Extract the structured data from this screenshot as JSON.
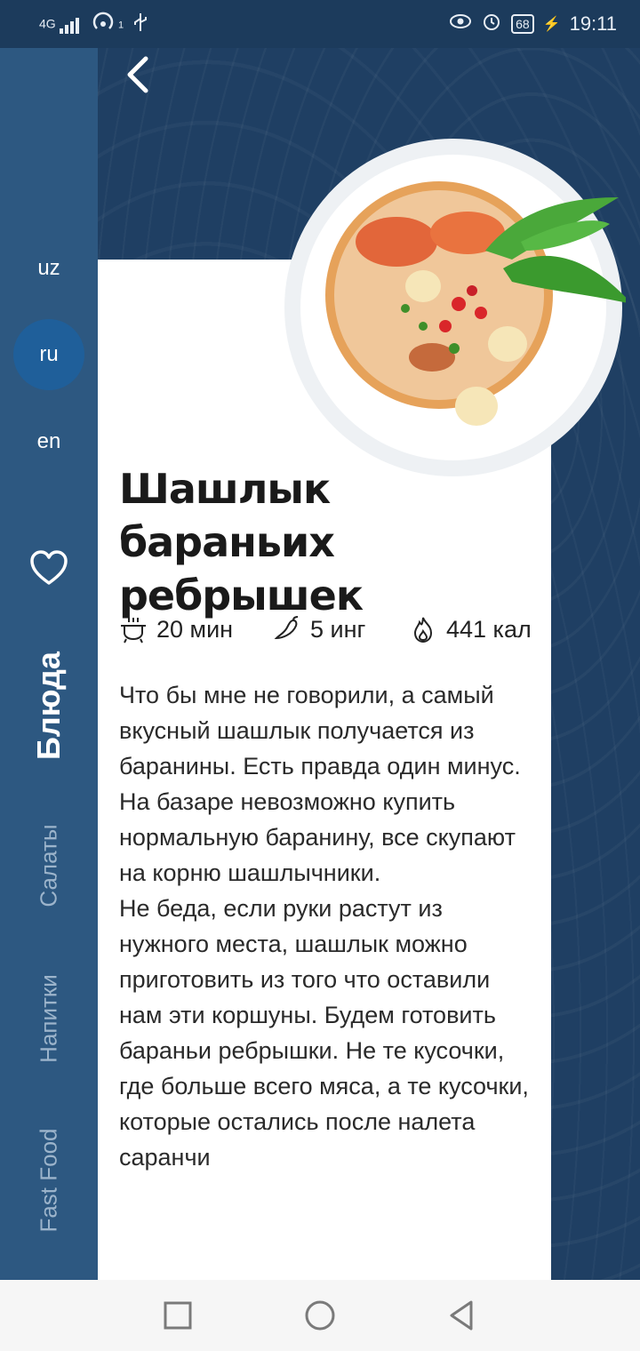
{
  "status_bar": {
    "network": "4G",
    "hotspot_count": "1",
    "battery": "68",
    "time": "19:11"
  },
  "languages": [
    {
      "code": "uz",
      "active": false
    },
    {
      "code": "ru",
      "active": true
    },
    {
      "code": "en",
      "active": false
    }
  ],
  "categories": [
    {
      "label": "Блюда",
      "active": true
    },
    {
      "label": "Салаты",
      "active": false
    },
    {
      "label": "Напитки",
      "active": false
    },
    {
      "label": "Fast Food",
      "active": false
    }
  ],
  "recipe": {
    "title": "Шашлык бараньих ребрышек",
    "time": "20 мин",
    "ingredients": "5 инг",
    "calories": "441 кал",
    "description": "Что бы мне не говорили, а самый вкусный шашлык получается из баранины. Есть правда один минус. На базаре невозможно купить нормальную баранину, все скупают на корню шашлычники.\nНе беда, если руки растут из нужного места, шашлык можно приготовить из того что оставили нам эти коршуны. Будем готовить бараньи ребрышки. Не те кусочки, где больше всего мяса, а те кусочки, которые остались после налета саранчи"
  },
  "icons": {
    "back": "chevron-left-icon",
    "favorite": "heart-icon",
    "time": "pot-icon",
    "ingredients": "pepper-icon",
    "calories": "flame-icon"
  },
  "colors": {
    "sidebar": "#2d5881",
    "hero": "#1f3f63",
    "active_lang": "#1f5f9a",
    "card": "#ffffff"
  }
}
